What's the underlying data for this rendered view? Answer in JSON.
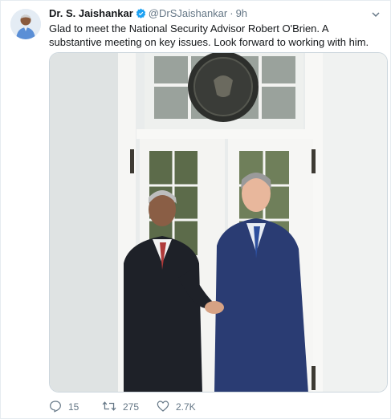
{
  "tweet": {
    "author_name": "Dr. S. Jaishankar",
    "handle": "@DrSJaishankar",
    "separator": "·",
    "time": "9h",
    "text": "Glad to meet the National Security Advisor Robert O'Brien. A substantive meeting on key issues. Look forward to working  with him.",
    "verified_icon": "verified-badge-icon",
    "accent_color": "#1da1f2"
  },
  "actions": {
    "reply_count": "15",
    "retweet_count": "275",
    "like_count": "2.7K"
  },
  "icons": [
    "avatar",
    "verified-badge-icon",
    "chevron-down-icon",
    "reply-icon",
    "retweet-icon",
    "heart-icon"
  ]
}
